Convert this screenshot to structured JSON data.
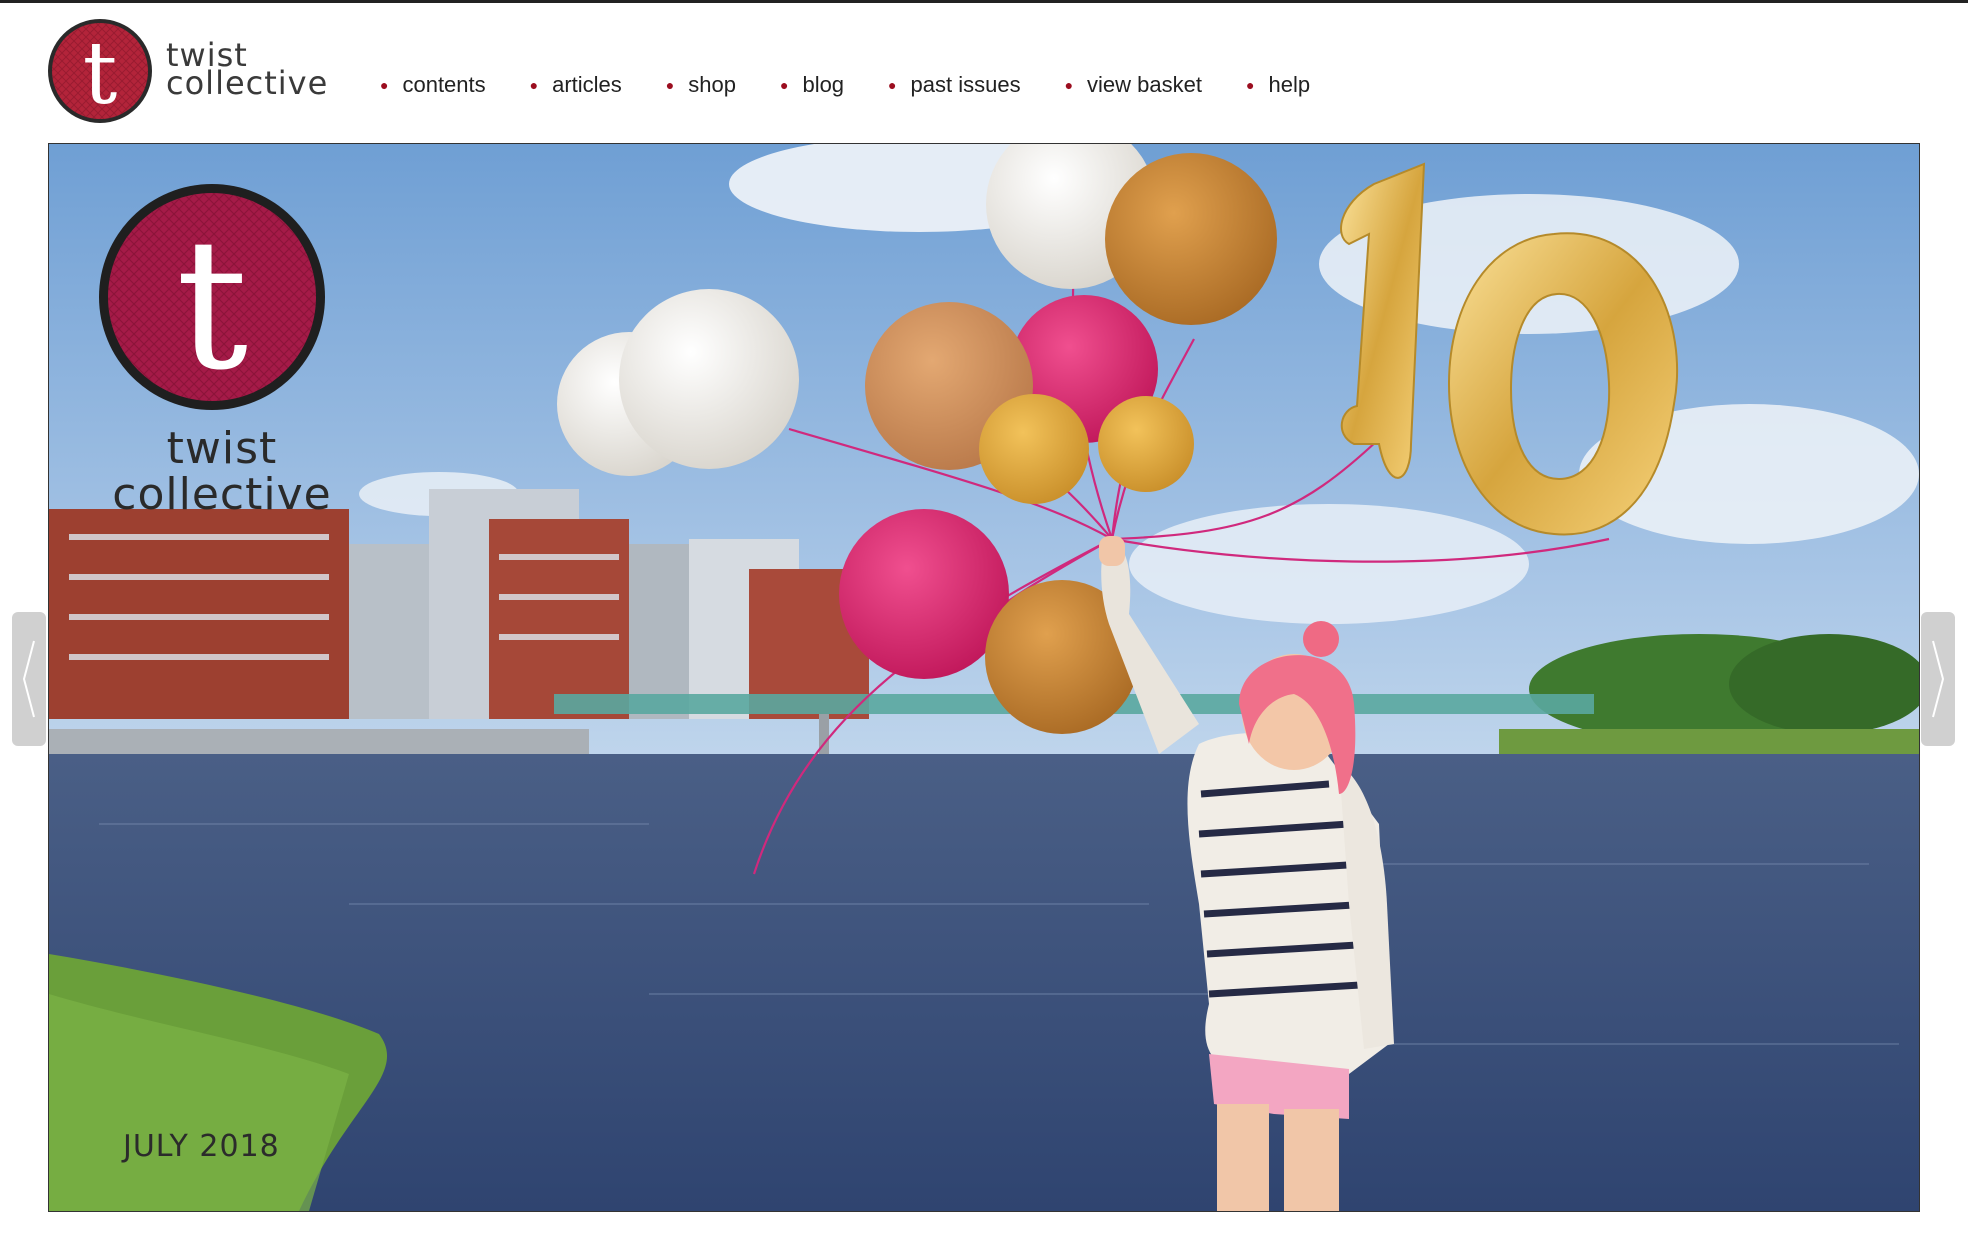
{
  "brand": {
    "name_line1": "twist",
    "name_line2": "collective",
    "logo_letter": "t",
    "color_red": "#9b0d1f",
    "color_badge": "#b01e44"
  },
  "nav": {
    "items": [
      {
        "label": "contents"
      },
      {
        "label": "articles"
      },
      {
        "label": "shop"
      },
      {
        "label": "blog"
      },
      {
        "label": "past issues"
      },
      {
        "label": "view basket"
      },
      {
        "label": "help"
      }
    ]
  },
  "cover": {
    "logo_line1": "twist",
    "logo_line2": "collective",
    "logo_letter": "t",
    "issue_date": "JULY 2018",
    "balloon_number": "10"
  },
  "slider": {
    "prev_icon": "chevron-left-icon",
    "next_icon": "chevron-right-icon"
  }
}
